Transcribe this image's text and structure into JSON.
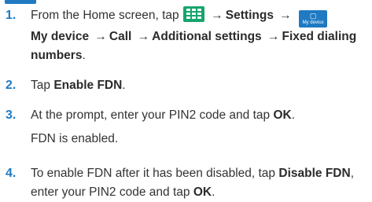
{
  "steps": [
    {
      "number": "1.",
      "parts": {
        "a": "From the Home screen, tap",
        "b": "Settings",
        "c": "My device",
        "d": "Call",
        "e": "Additional settings",
        "f": "Fixed dialing numbers",
        "end": "."
      },
      "icons": {
        "apps": "apps-grid-icon",
        "device": "my-device-icon",
        "device_label": "My device",
        "arrow": "→"
      }
    },
    {
      "number": "2.",
      "text": "Tap",
      "bold": "Enable FDN",
      "end": "."
    },
    {
      "number": "3.",
      "text": "At the prompt, enter your PIN2 code and tap",
      "bold": "OK",
      "end": ".",
      "sub": "FDN is enabled."
    },
    {
      "number": "4.",
      "text": "To enable FDN after it has been disabled, tap",
      "bold": "Disable FDN",
      "text2": ", enter your PIN2 code and tap",
      "bold2": "OK",
      "end": "."
    }
  ],
  "colors": {
    "accent": "#1f7ac2",
    "apps_icon": "#15a56c",
    "text": "#333333"
  }
}
